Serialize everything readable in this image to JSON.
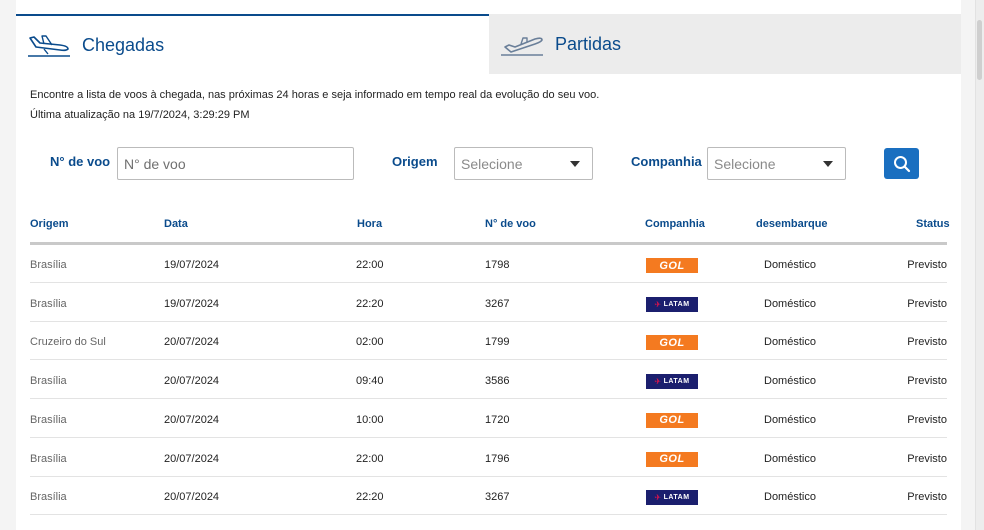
{
  "tabs": {
    "arrivals": {
      "label": "Chegadas",
      "icon": "plane-landing-icon",
      "active": true
    },
    "departures": {
      "label": "Partidas",
      "icon": "plane-takeoff-icon",
      "active": false
    }
  },
  "intro_text": "Encontre a lista de voos à chegada, nas próximas 24 horas e seja informado em tempo real da evolução do seu voo.",
  "last_updated": "Última atualização na 19/7/2024, 3:29:29 PM",
  "filters": {
    "flight": {
      "label": "N° de voo",
      "placeholder": "N° de voo"
    },
    "origin": {
      "label": "Origem",
      "value": "Selecione"
    },
    "airline": {
      "label": "Companhia",
      "value": "Selecione"
    },
    "search_icon": "search-icon"
  },
  "table": {
    "headers": {
      "origin": "Origem",
      "date": "Data",
      "time": "Hora",
      "flight": "N° de voo",
      "airline": "Companhia",
      "terminal": "desembarque",
      "status": "Status"
    },
    "rows": [
      {
        "origin": "Brasília",
        "date": "19/07/2024",
        "time": "22:00",
        "flight": "1798",
        "airline": "GOL",
        "terminal": "Doméstico",
        "status": "Previsto"
      },
      {
        "origin": "Brasília",
        "date": "19/07/2024",
        "time": "22:20",
        "flight": "3267",
        "airline": "LATAM",
        "terminal": "Doméstico",
        "status": "Previsto"
      },
      {
        "origin": "Cruzeiro do Sul",
        "date": "20/07/2024",
        "time": "02:00",
        "flight": "1799",
        "airline": "GOL",
        "terminal": "Doméstico",
        "status": "Previsto"
      },
      {
        "origin": "Brasília",
        "date": "20/07/2024",
        "time": "09:40",
        "flight": "3586",
        "airline": "LATAM",
        "terminal": "Doméstico",
        "status": "Previsto"
      },
      {
        "origin": "Brasília",
        "date": "20/07/2024",
        "time": "10:00",
        "flight": "1720",
        "airline": "GOL",
        "terminal": "Doméstico",
        "status": "Previsto"
      },
      {
        "origin": "Brasília",
        "date": "20/07/2024",
        "time": "22:00",
        "flight": "1796",
        "airline": "GOL",
        "terminal": "Doméstico",
        "status": "Previsto"
      },
      {
        "origin": "Brasília",
        "date": "20/07/2024",
        "time": "22:20",
        "flight": "3267",
        "airline": "LATAM",
        "terminal": "Doméstico",
        "status": "Previsto"
      }
    ]
  },
  "colors": {
    "brand_blue": "#0a4b8c",
    "button_blue": "#1a6fc0",
    "gol_orange": "#f47a20",
    "latam_navy": "#1b1f6e"
  }
}
